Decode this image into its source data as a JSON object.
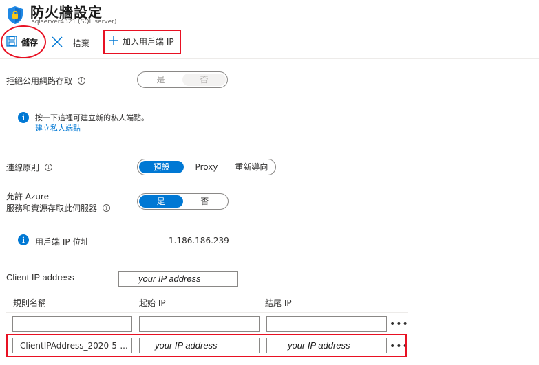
{
  "header": {
    "title": "防火牆設定",
    "subtitle": "sqlserver4321  (SQL server)",
    "icon": "sql-shield-icon"
  },
  "toolbar": {
    "save_label": "儲存",
    "discard_label": "捨棄",
    "add_client_ip_label": "加入用戶端 IP"
  },
  "deny_public_access": {
    "label": "拒絕公用網路存取",
    "options": [
      "是",
      "否"
    ],
    "selected": "否"
  },
  "private_endpoint_info": {
    "text": "按一下這裡可建立新的私人端點。",
    "link": "建立私人端點"
  },
  "connection_policy": {
    "label": "連線原則",
    "options": [
      "預設",
      "Proxy",
      "重新導向"
    ],
    "selected": "預設"
  },
  "allow_azure": {
    "label_line1": "允許 Azure",
    "label_line2": "服務和資源存取此伺服器",
    "options": [
      "是",
      "否"
    ],
    "selected": "是"
  },
  "client_ip": {
    "label": "用戶端 IP 位址",
    "value": "1.186.186.239"
  },
  "client_ip_address_field": {
    "label": "Client IP address",
    "value": "your IP address"
  },
  "rules_table": {
    "columns": [
      "規則名稱",
      "起始 IP",
      "結尾 IP"
    ],
    "rows": [
      {
        "name": "",
        "start_ip": "",
        "end_ip": ""
      },
      {
        "name": "ClientIPAddress_2020-5-...",
        "start_ip": "your IP address",
        "end_ip": "your IP address"
      }
    ],
    "more_label": "•••"
  },
  "colors": {
    "accent": "#0078d4",
    "annotation": "#e81123"
  }
}
